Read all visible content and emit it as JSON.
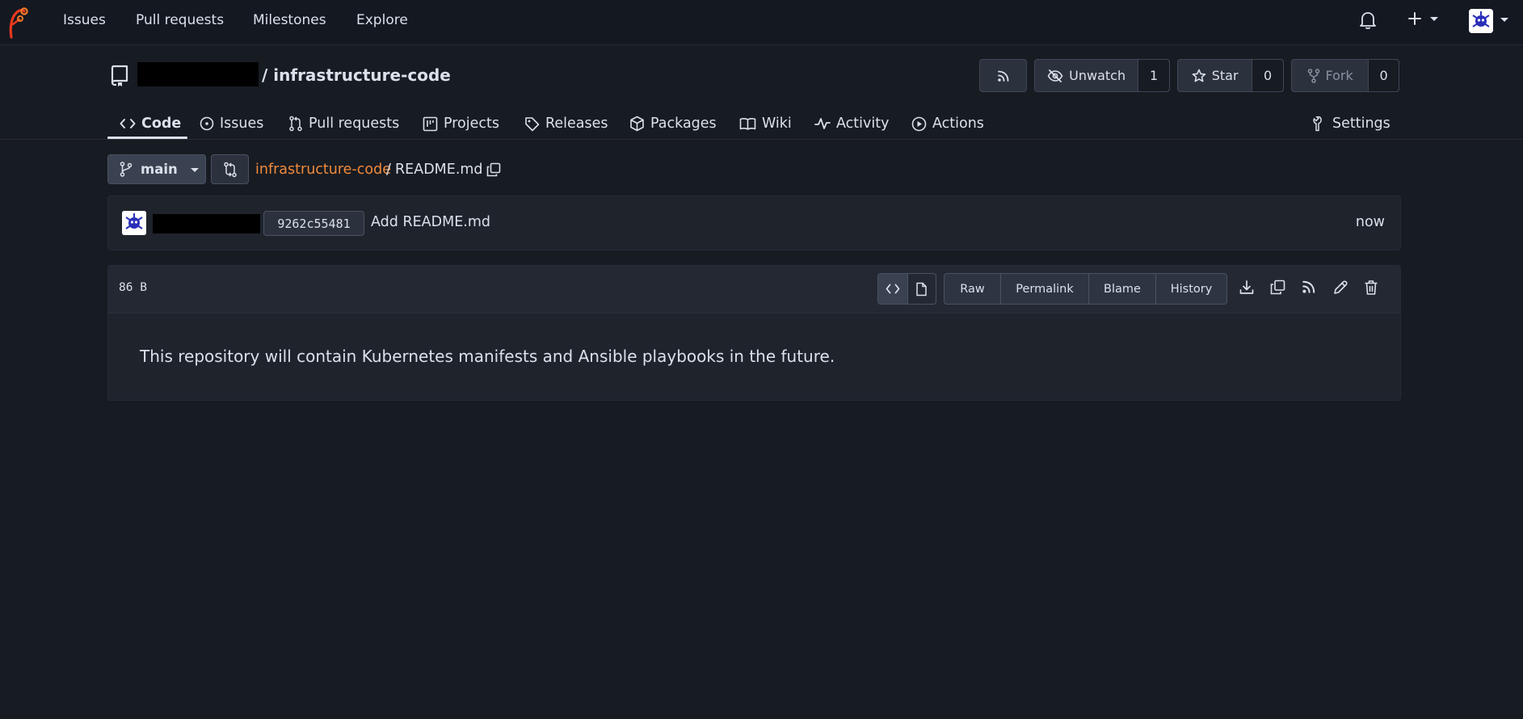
{
  "nav": {
    "links": [
      "Issues",
      "Pull requests",
      "Milestones",
      "Explore"
    ]
  },
  "repo": {
    "name": "/ infrastructure-code",
    "rss_icon": "rss-icon",
    "watch_label": "Unwatch",
    "watch_count": "1",
    "star_label": "Star",
    "star_count": "0",
    "fork_label": "Fork",
    "fork_count": "0"
  },
  "tabs": [
    "Code",
    "Issues",
    "Pull requests",
    "Projects",
    "Releases",
    "Packages",
    "Wiki",
    "Activity",
    "Actions"
  ],
  "settings_label": "Settings",
  "branch": {
    "name": "main",
    "path_root": "infrastructure-code",
    "path_sep": "/",
    "path_file": "README.md"
  },
  "commit": {
    "sha": "9262c55481",
    "message": "Add README.md",
    "time": "now"
  },
  "file": {
    "size": "86 B",
    "actions": [
      "Raw",
      "Permalink",
      "Blame",
      "History"
    ],
    "content": "This repository will contain Kubernetes manifests and Ansible playbooks in the future."
  },
  "colors": {
    "accent_link": "#f08a3c",
    "background": "#171b22",
    "logo": "#e8391c"
  }
}
